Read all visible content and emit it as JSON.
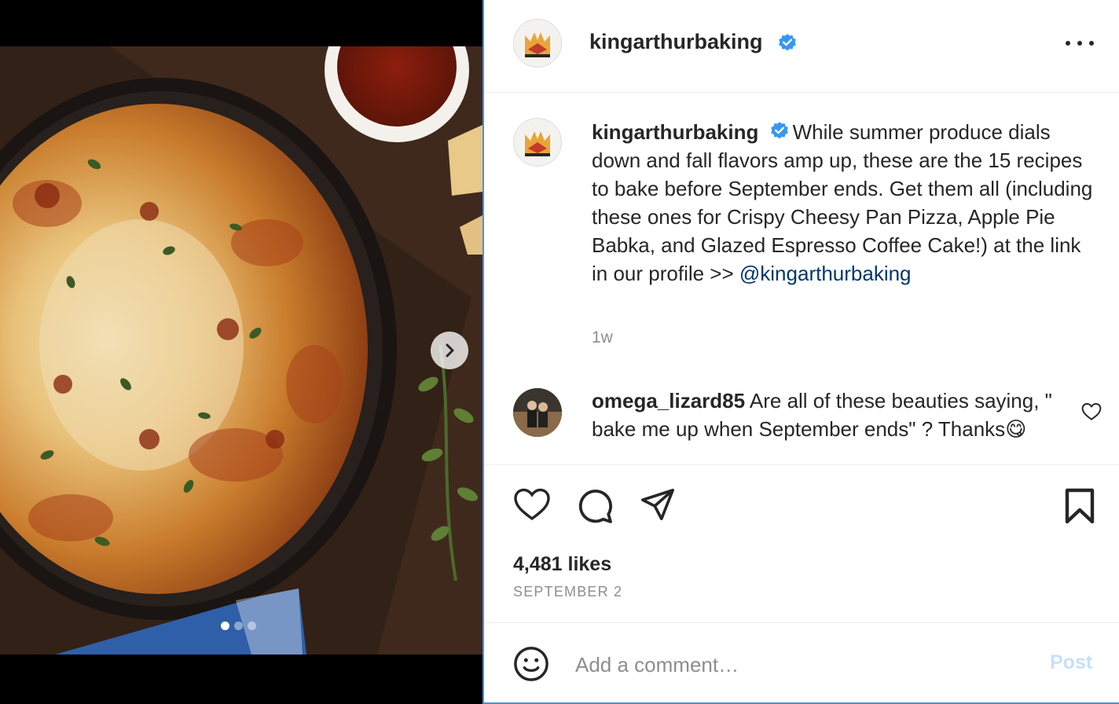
{
  "post": {
    "username": "kingarthurbaking",
    "verified_icon": "verified-badge-icon",
    "more_icon": "more-options-icon",
    "media": {
      "slide_count": 3,
      "active_slide": 1,
      "next_icon": "chevron-right-icon"
    }
  },
  "caption": {
    "username": "kingarthurbaking",
    "text": "While summer produce dials down and fall flavors amp up, these are the 15 recipes to bake before September ends. Get them all (including these ones for Crispy Cheesy Pan Pizza, Apple Pie Babka, and Glazed Espresso Coffee Cake!) at the link in our profile >> ",
    "mention": "@kingarthurbaking",
    "time": "1w"
  },
  "comments": [
    {
      "username": "omega_lizard85",
      "text": "Are all of these beauties saying, \" bake me up when September ends\" ? Thanks",
      "emoji": "😋"
    }
  ],
  "actions": {
    "like_icon": "heart-icon",
    "comment_icon": "comment-icon",
    "share_icon": "paper-plane-icon",
    "save_icon": "bookmark-icon"
  },
  "likes": "4,481 likes",
  "date": "SEPTEMBER 2",
  "comment_box": {
    "placeholder": "Add a comment…",
    "post_label": "Post",
    "emoji_icon": "smiley-icon"
  },
  "colors": {
    "accent_blue": "#0095f6",
    "post_disabled": "#c7e0fa",
    "mention": "#00376b",
    "verified": "#3897f0"
  }
}
